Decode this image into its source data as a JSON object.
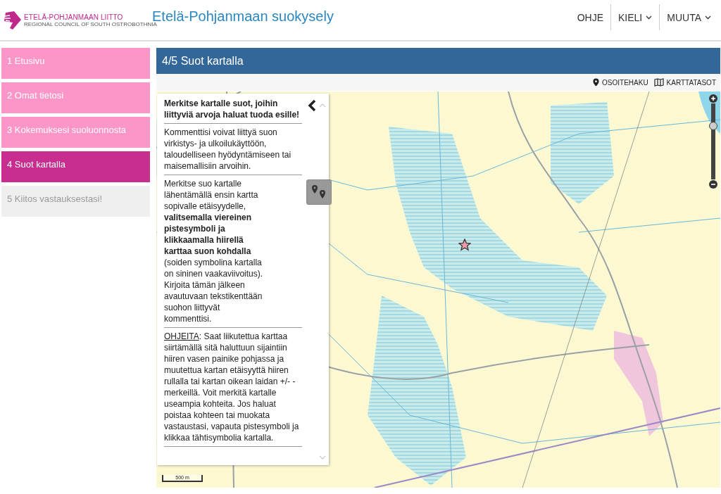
{
  "header": {
    "logo_name": "ETELÄ-POHJANMAAN LIITTO",
    "logo_subtitle": "REGIONAL COUNCIL OF SOUTH OSTROBOTHNIA",
    "title": "Etelä-Pohjanmaan suokysely",
    "nav": [
      {
        "label": "OHJE",
        "dropdown": false
      },
      {
        "label": "KIELI",
        "dropdown": true
      },
      {
        "label": "MUUTA",
        "dropdown": true
      }
    ]
  },
  "steps": [
    {
      "label": "1 Etusivu",
      "selected": false,
      "disabled": false
    },
    {
      "label": "2 Omat tietosi",
      "selected": false,
      "disabled": false
    },
    {
      "label": "3 Kokemuksesi suoluonnosta",
      "selected": false,
      "disabled": false
    },
    {
      "label": "4 Suot kartalla",
      "selected": true,
      "disabled": false
    },
    {
      "label": "5 Kiitos vastauksestasi!",
      "selected": false,
      "disabled": true
    }
  ],
  "page_title": "4/5 Suot kartalla",
  "map_tools": [
    {
      "kind": "search",
      "label": "OSOITEHAKU"
    },
    {
      "kind": "layers",
      "label": "KARTTATASOT"
    }
  ],
  "panel": {
    "heading": "Merkitse kartalle suot, joihin liittyviä arvoja haluat tuoda esille!",
    "intro": "Kommenttisi voivat liittyä suon virkistys- ja ulkoilukäyttöön, taloudelliseen hyödyntämiseen tai maisemallisiin arvoihin.",
    "instructions": "Merkitse suo kartalle lähentämällä ensin kartta sopivalle etäisyydelle, **valitsemalla viereinen pistesymboli ja klikkaamalla hiirellä karttaa suon kohdalla** (soiden symbolina kartalla on sininen vaakaviivoitus). Kirjoita tämän jälkeen avautuvaan tekstikenttään suohon liittyvät kommenttisi.",
    "help_link": "OHJEITA",
    "help_text": ": Saat liikutettua karttaa siirtämällä sitä haluttuun sijaintiin hiiren vasen painike pohjassa ja muutettua kartan etäisyyttä hiiren rullalla tai kartan oikean laidan +/- -merkeillä. Voit merkitä kartalle useampia kohteita. Jos haluat poistaa kohteen tai muokata vastaustasi, vapauta pistesymboli ja klikkaa tähtisymbolia kartalla."
  },
  "zoom": {
    "level": 0.7
  },
  "scale": "500 m"
}
